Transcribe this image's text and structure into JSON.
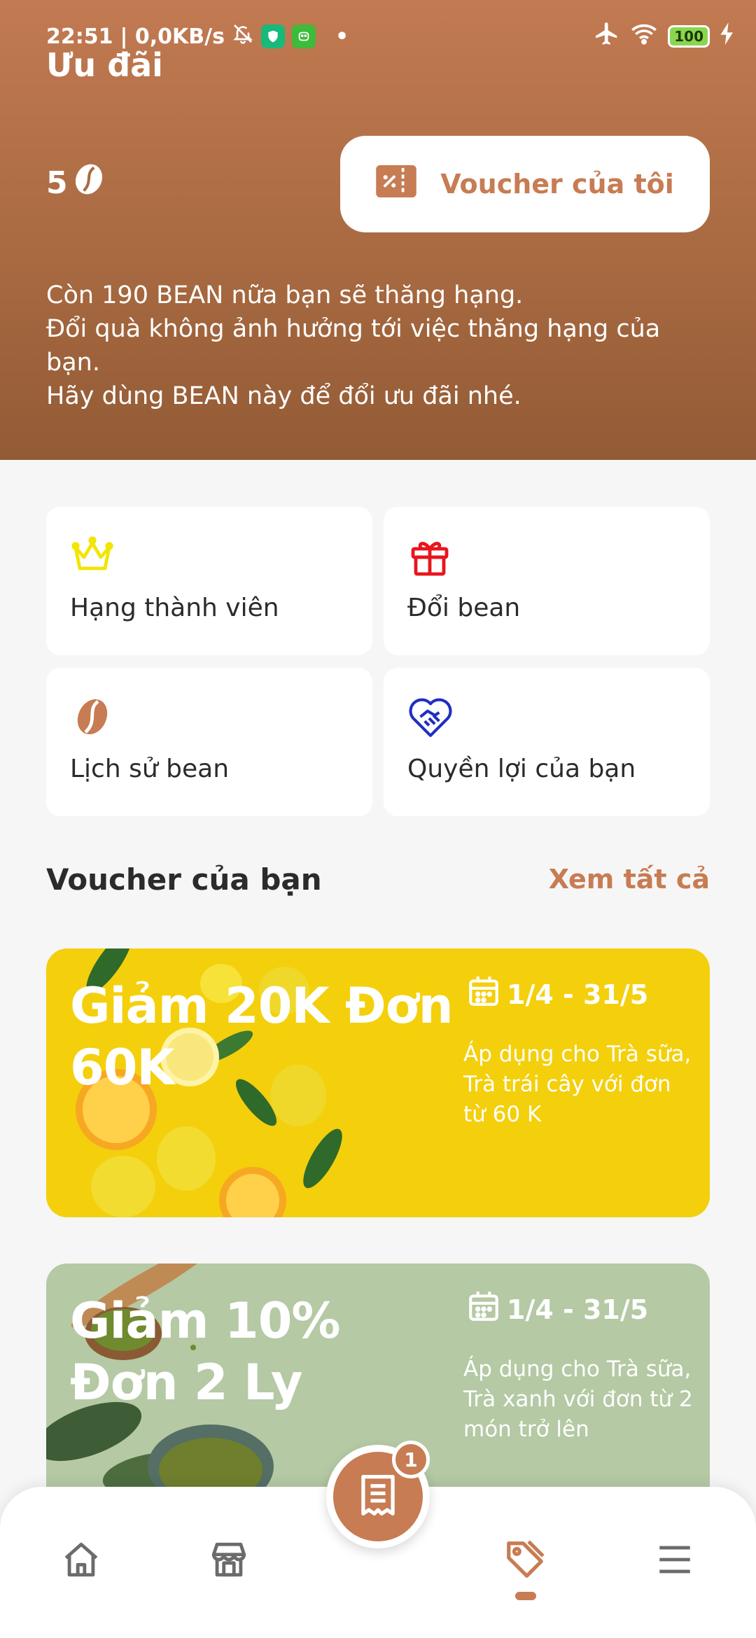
{
  "status": {
    "time": "22:51",
    "net": "| 0,0KB/s",
    "battery": "100",
    "dot": "•"
  },
  "header": {
    "title": "Ưu đãi",
    "bean_count": "5",
    "my_voucher_label": "Voucher của tôi",
    "info_lines": [
      "Còn 190 BEAN nữa bạn sẽ thăng hạng.",
      "Đổi quà không ảnh hưởng tới việc thăng hạng của bạn.",
      "Hãy dùng BEAN này để đổi ưu đãi nhé."
    ]
  },
  "tiles": [
    {
      "label": "Hạng thành viên",
      "icon": "crown-icon",
      "color": "#f2e500"
    },
    {
      "label": "Đổi bean",
      "icon": "gift-icon",
      "color": "#e8151d"
    },
    {
      "label": "Lịch sử bean",
      "icon": "coffee-bean-icon",
      "color": "#c77c53"
    },
    {
      "label": "Quyền lợi của bạn",
      "icon": "heart-handshake-icon",
      "color": "#1f2fc2"
    }
  ],
  "vouchers_section": {
    "title": "Voucher của bạn",
    "see_all": "Xem tất cả"
  },
  "vouchers": [
    {
      "title": "Giảm 20K Đơn 60K",
      "date": "1/4 - 31/5",
      "desc": "Áp dụng cho Trà sữa, Trà trái cây với đơn từ 60 K",
      "bg": "#f4cf0c"
    },
    {
      "title": "Giảm 10% Đơn 2 Ly",
      "date": "1/4 - 31/5",
      "desc": "Áp dụng cho Trà sữa, Trà xanh với đơn từ 2 món trở lên",
      "bg": "#b4c9a4"
    }
  ],
  "bottom_nav": {
    "items": [
      "home-icon",
      "store-icon",
      "receipt-icon",
      "tag-icon",
      "menu-icon"
    ],
    "cart_badge": "1",
    "accent": "#c77c53"
  }
}
